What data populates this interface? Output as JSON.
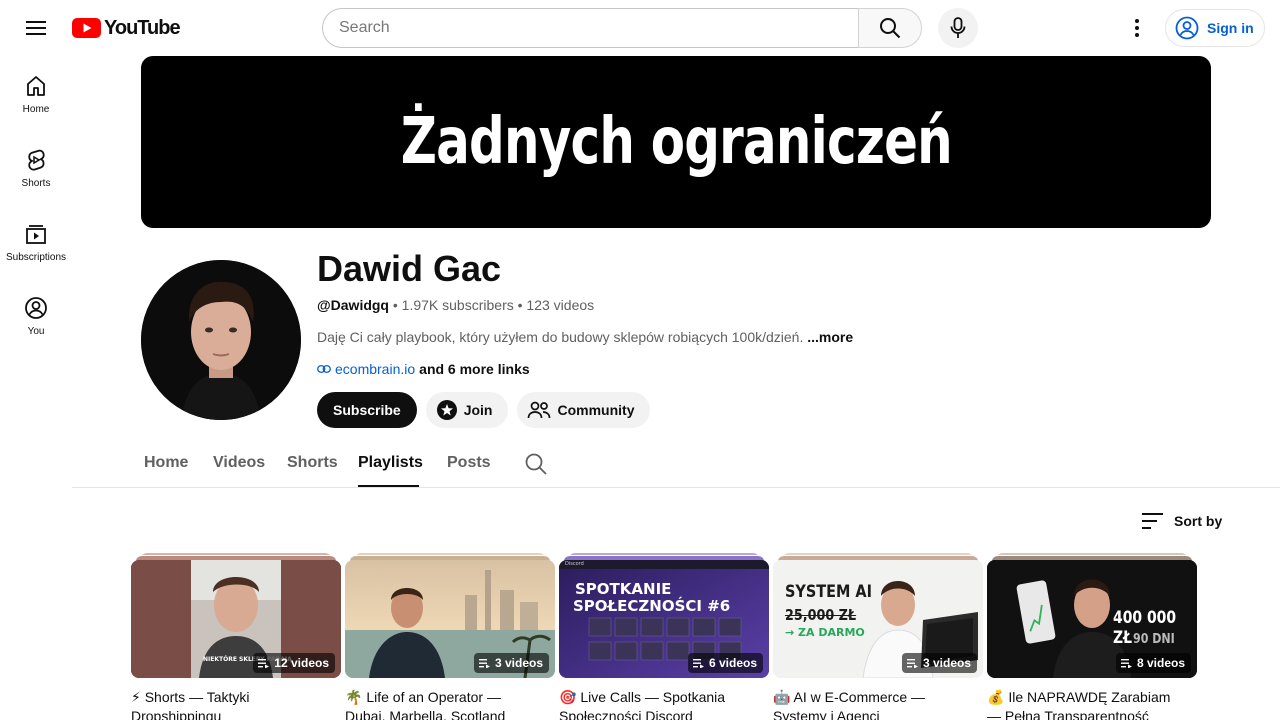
{
  "header": {
    "logo_text": "YouTube",
    "search_placeholder": "Search",
    "signin_label": "Sign in"
  },
  "sidenav": {
    "items": [
      {
        "label": "Home",
        "icon": "home-icon"
      },
      {
        "label": "Shorts",
        "icon": "shorts-icon"
      },
      {
        "label": "Subscriptions",
        "icon": "subscriptions-icon"
      },
      {
        "label": "You",
        "icon": "you-icon"
      }
    ]
  },
  "banner": {
    "text": "Żadnych ograniczeń"
  },
  "channel": {
    "name": "Dawid Gac",
    "handle": "@Dawidgq",
    "subscribers": "1.97K subscribers",
    "videos": "123 videos",
    "separator": "•",
    "description": "Daję Ci cały playbook, który użyłem do budowy sklepów robiących 100k/dzień.",
    "more_label": "...more",
    "link_text": "ecombrain.io",
    "more_links": "and 6 more links",
    "subscribe_label": "Subscribe",
    "join_label": "Join",
    "community_label": "Community"
  },
  "tabs": {
    "items": [
      "Home",
      "Videos",
      "Shorts",
      "Playlists",
      "Posts"
    ],
    "active": "Playlists"
  },
  "sort_label": "Sort by",
  "playlists": [
    {
      "title_line1": "⚡ Shorts — Taktyki",
      "title_line2": "Dropshippingu",
      "count": "12 videos",
      "thumb_text": "NIEKTÓRE SKLEPY PADAJĄ",
      "thumb_highlight": "SKLEPY"
    },
    {
      "title_line1": "🌴 Life of an Operator —",
      "title_line2": "Dubai, Marbella, Scotland",
      "count": "3 videos"
    },
    {
      "title_line1": "🎯 Live Calls — Spotkania",
      "title_line2": "Społeczności Discord",
      "count": "6 videos",
      "thumb_line1": "SPOTKANIE",
      "thumb_line2": "SPOŁECZNOŚCI #6",
      "thumb_app": "Discord"
    },
    {
      "title_line1": "🤖 AI w E-Commerce —",
      "title_line2": "Systemy i Agenci",
      "count": "3 videos",
      "thumb_line1": "SYSTEM AI",
      "thumb_line2": "25,000 ZŁ",
      "thumb_line3": "→ ZA DARMO"
    },
    {
      "title_line1": "💰 Ile NAPRAWDĘ Zarabiam",
      "title_line2": "— Pełna Transparentność",
      "count": "8 videos",
      "thumb_line1": "400 000 ZŁ",
      "thumb_line2": "90 DNI"
    }
  ],
  "colors": {
    "brand_red": "#ff0000",
    "link_blue": "#065fd4"
  }
}
